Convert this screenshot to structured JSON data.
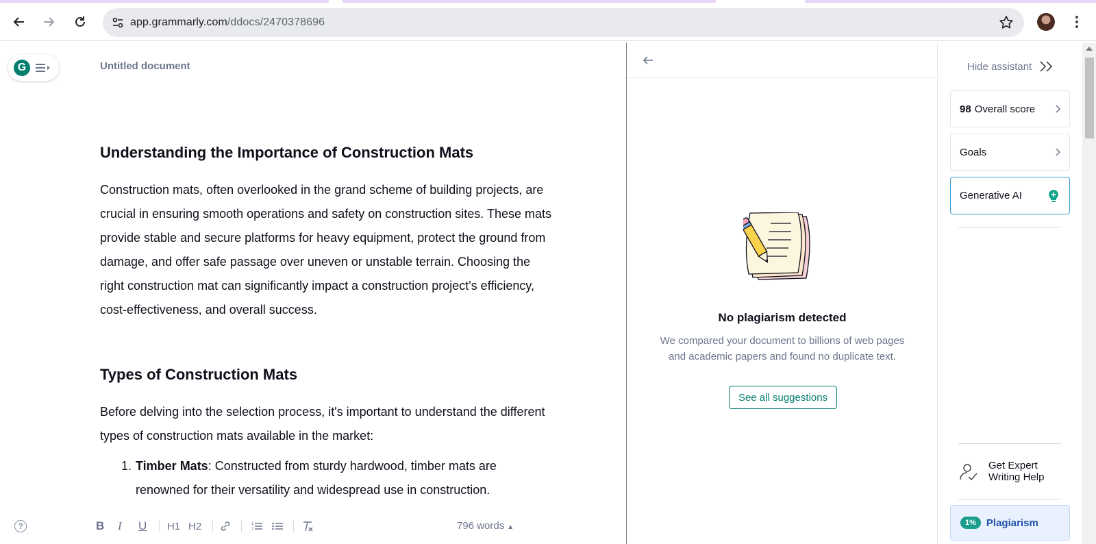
{
  "browser": {
    "url_host": "app.grammarly.com",
    "url_path": "/ddocs/2470378696"
  },
  "editor": {
    "doc_title": "Untitled document",
    "heading1": "Understanding the Importance of Construction Mats",
    "paragraph1": "Construction mats, often overlooked in the grand scheme of building projects, are crucial in ensuring smooth operations and safety on construction sites. These mats provide stable and secure platforms for heavy equipment, protect the ground from damage, and offer safe passage over uneven or unstable terrain. Choosing the right construction mat can significantly impact a construction project's efficiency, cost-effectiveness, and overall success.",
    "heading2": "Types of Construction Mats",
    "paragraph2": "Before delving into the selection process, it's important to understand the different types of construction mats available in the market:",
    "list_item1_number": "1.",
    "list_item1_bold": "Timber Mats",
    "list_item1_text": ": Constructed from sturdy hardwood, timber mats are renowned for their versatility and widespread use in construction.",
    "word_count": "796 words",
    "help_label": "?",
    "format": {
      "bold": "B",
      "italic": "I",
      "underline": "U",
      "h1": "H1",
      "h2": "H2"
    }
  },
  "plagiarism_panel": {
    "title": "No plagiarism detected",
    "description": "We compared your document to billions of web pages and academic papers and found no duplicate text.",
    "see_all": "See all suggestions"
  },
  "assistant": {
    "hide_label": "Hide assistant",
    "score_value": "98",
    "score_label": "Overall score",
    "goals_label": "Goals",
    "generative_ai_label": "Generative AI",
    "expert_label": "Get Expert Writing Help",
    "plagiarism_pct": "1%",
    "plagiarism_label": "Plagiarism"
  },
  "colors": {
    "brand_green": "#027e6f",
    "plagiarism_card_bg": "#e8f1fd",
    "plagiarism_label": "#1f4fa8",
    "text_muted": "#6d758d"
  }
}
